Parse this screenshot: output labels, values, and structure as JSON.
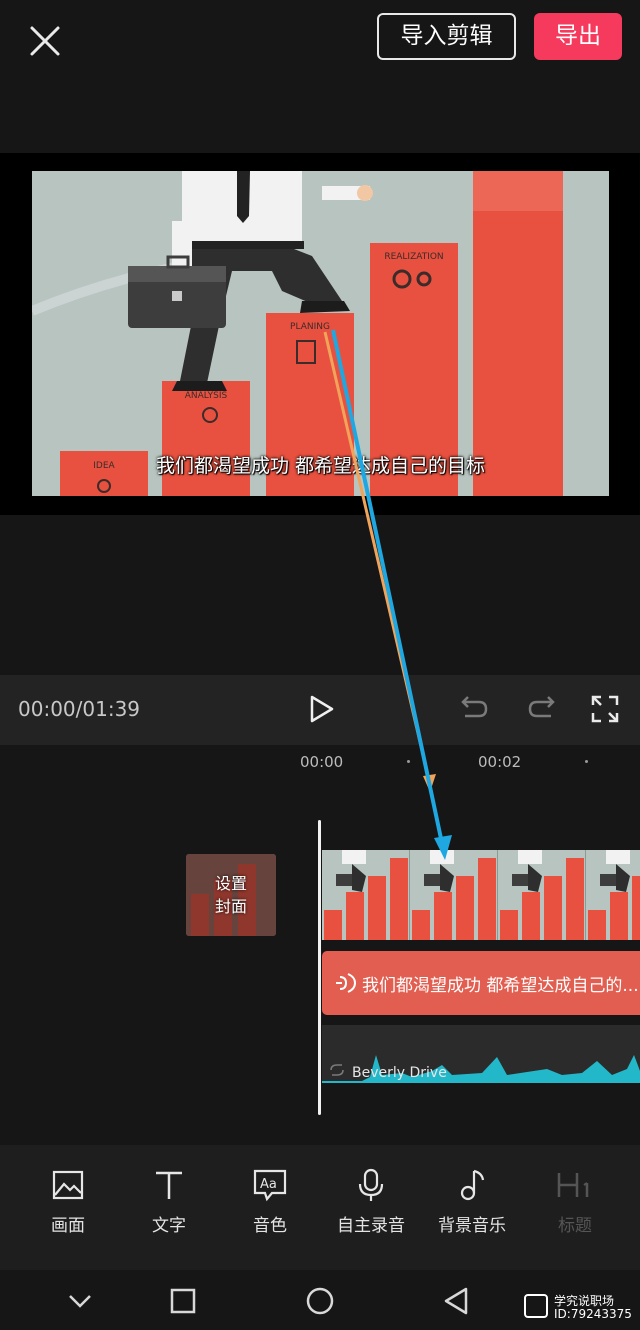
{
  "header": {
    "close_icon": "close-icon",
    "import_label": "导入剪辑",
    "export_label": "导出",
    "export_color": "#f53a5d"
  },
  "preview": {
    "subtitle": "我们都渴望成功 都希望达成自己的目标",
    "stair_labels": [
      "IDEA",
      "ANALYSIS",
      "PLANING",
      "REALIZATION"
    ],
    "bar_color": "#e8513f"
  },
  "controls": {
    "timecode": "00:00/01:39",
    "play_icon": "play-icon",
    "undo_icon": "undo-icon",
    "redo_icon": "redo-icon",
    "fullscreen_icon": "fullscreen-icon"
  },
  "timeline": {
    "ruler": [
      "00:00",
      "00:02"
    ],
    "cover_label_line1": "设置",
    "cover_label_line2": "封面",
    "text_track_label": "我们都渴望成功 都希望达成自己的...",
    "text_track_color": "#e15e50",
    "audio_track_label": "Beverly Drive",
    "waveform_color": "#23b8c9"
  },
  "toolbar": {
    "items": [
      {
        "label": "画面",
        "icon": "image-icon",
        "enabled": true
      },
      {
        "label": "文字",
        "icon": "text-icon",
        "enabled": true
      },
      {
        "label": "音色",
        "icon": "voice-tone-icon",
        "enabled": true
      },
      {
        "label": "自主录音",
        "icon": "microphone-icon",
        "enabled": true
      },
      {
        "label": "背景音乐",
        "icon": "music-note-icon",
        "enabled": true
      },
      {
        "label": "标题",
        "icon": "heading-icon",
        "enabled": false
      }
    ]
  },
  "navbar": {
    "icons": [
      "chevron-down-icon",
      "square-icon",
      "circle-icon",
      "back-triangle-icon"
    ]
  },
  "watermark": {
    "line1": "学究说职场",
    "line2": "ID:79243375"
  }
}
